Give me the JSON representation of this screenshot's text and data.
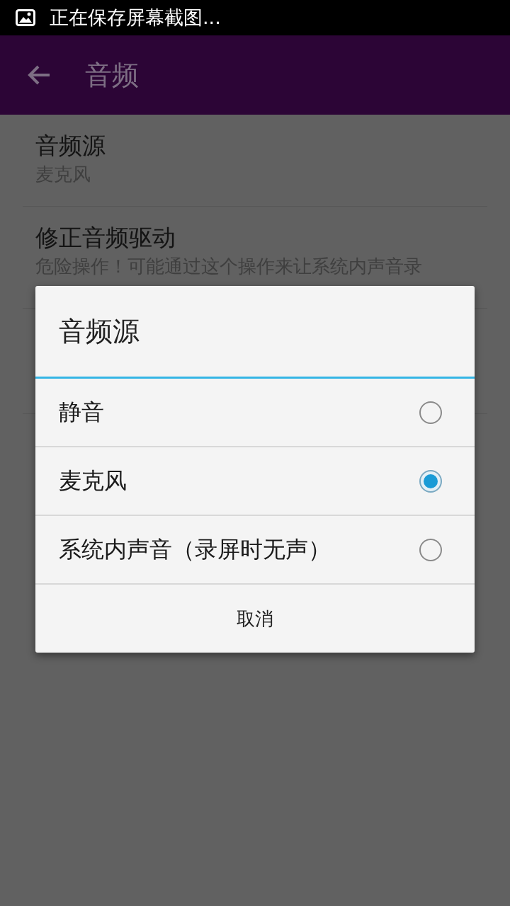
{
  "status_bar": {
    "notification": "正在保存屏幕截图..."
  },
  "app_bar": {
    "title": "音频"
  },
  "settings": [
    {
      "title": "音频源",
      "summary": "麦克风"
    },
    {
      "title": "修正音频驱动",
      "summary": "危险操作！可能通过这个操作来让系统内声音录"
    }
  ],
  "dialog": {
    "title": "音频源",
    "options": [
      {
        "label": "静音",
        "selected": false
      },
      {
        "label": "麦克风",
        "selected": true
      },
      {
        "label": "系统内声音（录屏时无声）",
        "selected": false
      }
    ],
    "button": "取消"
  }
}
